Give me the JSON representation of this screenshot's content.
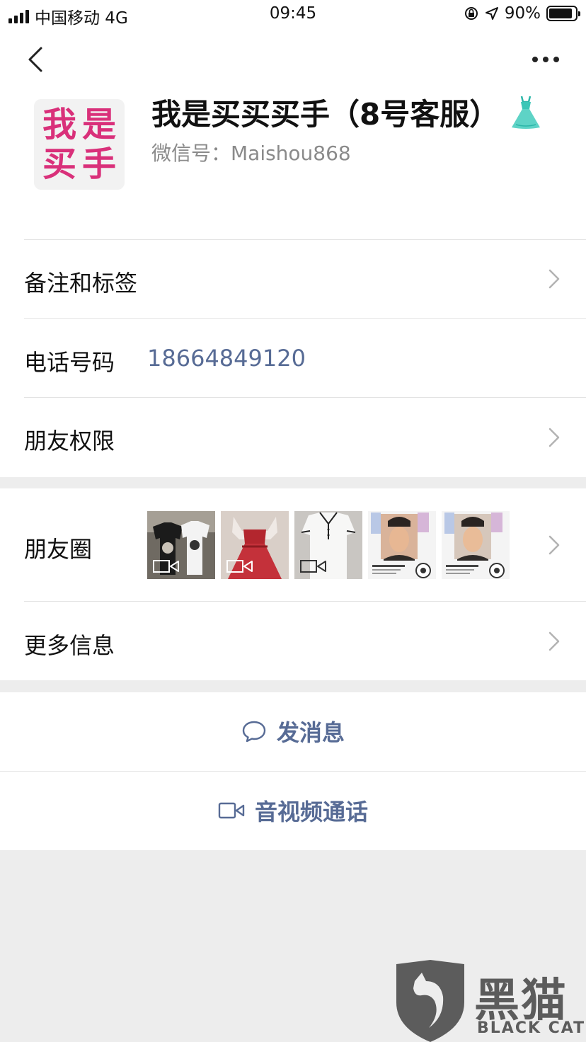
{
  "status_bar": {
    "carrier": "中国移动 4G",
    "time": "09:45",
    "battery_percent": "90%",
    "battery_level": 0.9
  },
  "header": {
    "back_icon": "chevron-left-icon",
    "more_icon": "ellipsis-icon"
  },
  "profile": {
    "avatar_text": [
      "我",
      "是",
      "买",
      "手"
    ],
    "name": "我是买买买手（8号客服）",
    "name_emoji_icon": "dress-icon",
    "wechat_id": "微信号：Maishou868"
  },
  "rows": {
    "remarks_label": "备注和标签",
    "phone_label": "电话号码",
    "phone_value": "18664849120",
    "permissions_label": "朋友权限",
    "moments_label": "朋友圈",
    "more_info_label": "更多信息"
  },
  "moments_thumbnails": [
    {
      "kind": "video",
      "scene": "t-shirts"
    },
    {
      "kind": "video",
      "scene": "red-dress"
    },
    {
      "kind": "video",
      "scene": "white-polo-dress"
    },
    {
      "kind": "image",
      "scene": "man-portrait"
    },
    {
      "kind": "image",
      "scene": "man-portrait"
    }
  ],
  "actions": {
    "message_label": "发消息",
    "call_label": "音视频通话"
  },
  "watermark": {
    "text": "黑猫",
    "sub": "BLACK CAT"
  },
  "colors": {
    "link_blue": "#576b95",
    "avatar_pink": "#d9307a",
    "background_gray": "#ededed"
  }
}
